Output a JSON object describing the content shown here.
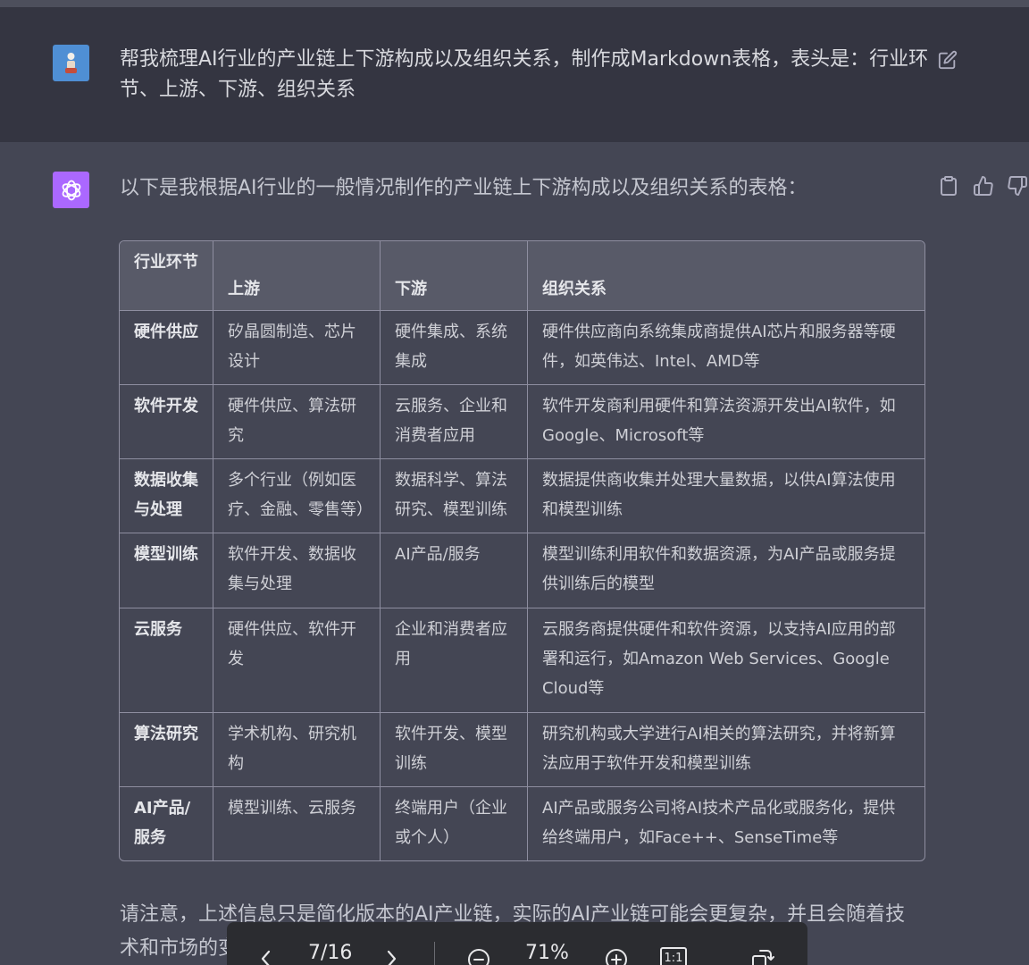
{
  "user_message": {
    "text": "帮我梳理AI行业的产业链上下游构成以及组织关系，制作成Markdown表格，表头是：行业环节、上游、下游、组织关系"
  },
  "assistant_message": {
    "intro": "以下是我根据AI行业的一般情况制作的产业链上下游构成以及组织关系的表格：",
    "table": {
      "headers": [
        "行业环节",
        "上游",
        "下游",
        "组织关系"
      ],
      "rows": [
        [
          "硬件供应",
          "矽晶圆制造、芯片设计",
          "硬件集成、系统集成",
          "硬件供应商向系统集成商提供AI芯片和服务器等硬件，如英伟达、Intel、AMD等"
        ],
        [
          "软件开发",
          "硬件供应、算法研究",
          "云服务、企业和消费者应用",
          "软件开发商利用硬件和算法资源开发出AI软件，如Google、Microsoft等"
        ],
        [
          "数据收集与处理",
          "多个行业（例如医疗、金融、零售等）",
          "数据科学、算法研究、模型训练",
          "数据提供商收集并处理大量数据，以供AI算法使用和模型训练"
        ],
        [
          "模型训练",
          "软件开发、数据收集与处理",
          "AI产品/服务",
          "模型训练利用软件和数据资源，为AI产品或服务提供训练后的模型"
        ],
        [
          "云服务",
          "硬件供应、软件开发",
          "企业和消费者应用",
          "云服务商提供硬件和软件资源，以支持AI应用的部署和运行，如Amazon Web Services、Google Cloud等"
        ],
        [
          "算法研究",
          "学术机构、研究机构",
          "软件开发、模型训练",
          "研究机构或大学进行AI相关的算法研究，并将新算法应用于软件开发和模型训练"
        ],
        [
          "AI产品/服务",
          "模型训练、云服务",
          "终端用户（企业或个人）",
          "AI产品或服务公司将AI技术产品化或服务化，提供给终端用户，如Face++、SenseTime等"
        ]
      ]
    },
    "footnote": "请注意，上述信息只是简化版本的AI产业链，实际的AI产业链可能会更复杂，并且会随着技术和市场的变化而变化。"
  },
  "pdf_toolbar": {
    "page_indicator": "7/16",
    "zoom": "71%",
    "fit_label": "1:1"
  },
  "colors": {
    "assistant_bg": "#444654",
    "user_bg": "#343541",
    "gpt_avatar": "#ab68ff",
    "table_header_bg": "#585a68"
  }
}
